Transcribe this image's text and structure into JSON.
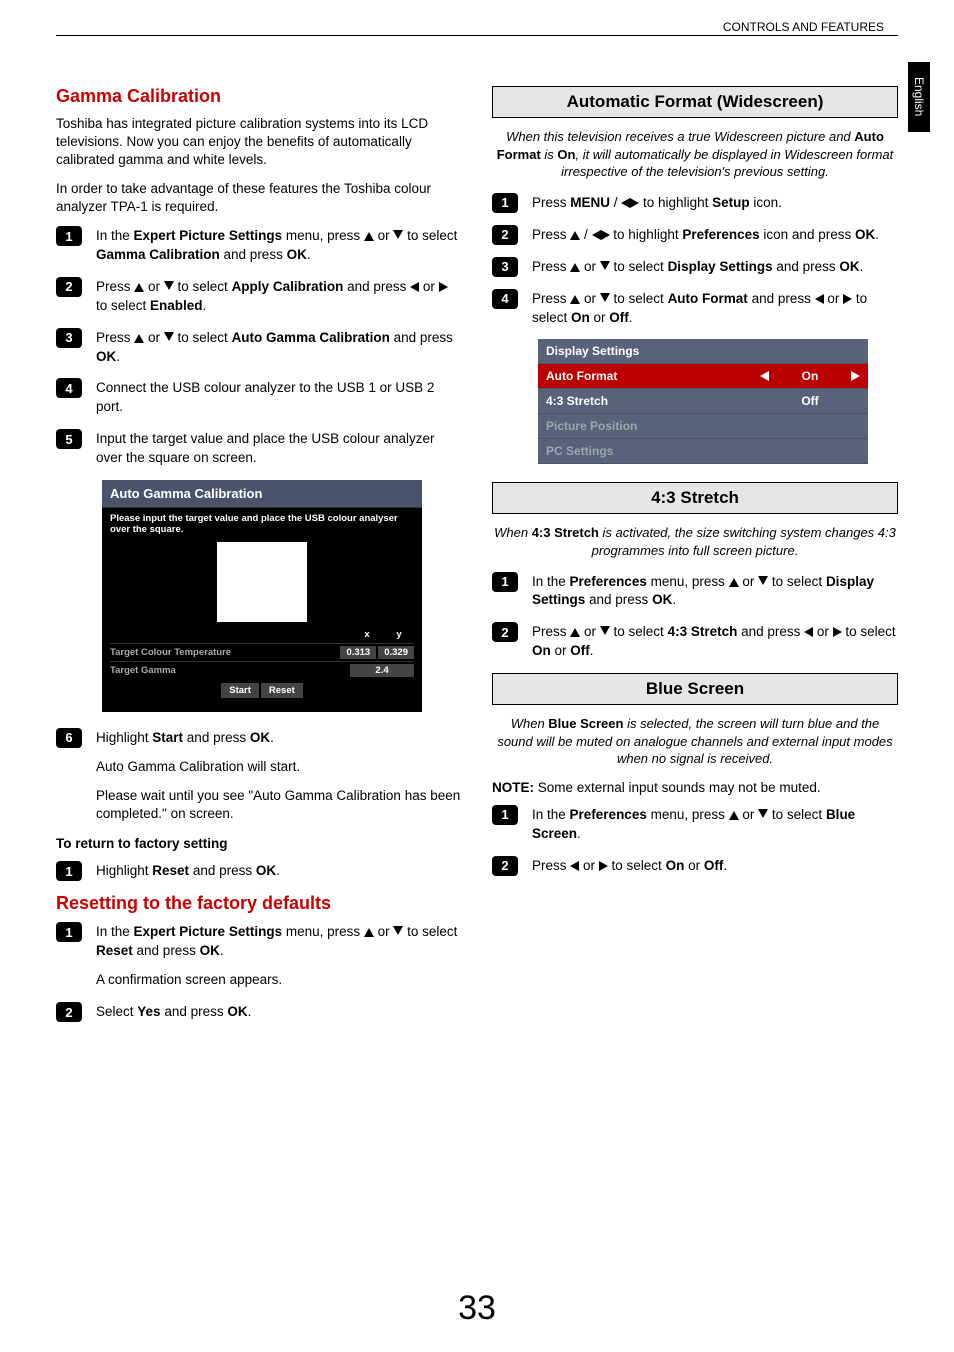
{
  "breadcrumb": "CONTROLS AND FEATURES",
  "sideTab": "English",
  "pageNumber": "33",
  "left": {
    "h1": "Gamma Calibration",
    "intro1": "Toshiba has integrated picture calibration systems into its LCD televisions. Now you can enjoy the benefits of automatically calibrated gamma and white levels.",
    "intro2": "In order to take advantage of these features the Toshiba colour analyzer TPA-1 is required.",
    "s1a": "In the ",
    "s1b": "Expert Picture Settings",
    "s1c": " menu, press ",
    "s1d": " or ",
    "s1e": " to select ",
    "s1f": "Gamma Calibration",
    "s1g": " and press ",
    "s1h": "OK",
    "s1i": ".",
    "s2a": "Press ",
    "s2b": " or ",
    "s2c": " to select ",
    "s2d": "Apply Calibration",
    "s2e": " and press ",
    "s2f": " or ",
    "s2g": " to select ",
    "s2h": "Enabled",
    "s2i": ".",
    "s3a": "Press ",
    "s3b": " or ",
    "s3c": " to select ",
    "s3d": "Auto Gamma Calibration",
    "s3e": " and press ",
    "s3f": "OK",
    "s3g": ".",
    "s4": "Connect the USB colour analyzer to the USB 1 or USB 2 port.",
    "s5": "Input the target value and place the USB colour analyzer over the square on screen.",
    "osd": {
      "title": "Auto Gamma Calibration",
      "sub": "Please input the target value and place the USB colour analyser over the square.",
      "xHead": "x",
      "yHead": "y",
      "row1l": "Target Colour Temperature",
      "row1x": "0.313",
      "row1y": "0.329",
      "row2l": "Target Gamma",
      "row2v": "2.4",
      "btnStart": "Start",
      "btnReset": "Reset"
    },
    "s6a": "Highlight ",
    "s6b": "Start",
    "s6c": " and press ",
    "s6d": "OK",
    "s6e": ".",
    "s6f": "Auto Gamma Calibration will start.",
    "s6g": "Please wait until you see \"Auto Gamma Calibration has been completed.\" on screen.",
    "returnH": "To return to factory setting",
    "r1a": "Highlight ",
    "r1b": "Reset",
    "r1c": " and press ",
    "r1d": "OK",
    "r1e": ".",
    "h2": "Resetting to the factory defaults",
    "rf1a": "In the ",
    "rf1b": "Expert Picture Settings",
    "rf1c": " menu, press ",
    "rf1d": " or ",
    "rf1e": " to select ",
    "rf1f": "Reset",
    "rf1g": " and press ",
    "rf1h": "OK",
    "rf1i": ".",
    "rf1j": "A confirmation screen appears.",
    "rf2a": "Select ",
    "rf2b": "Yes",
    "rf2c": " and press ",
    "rf2d": "OK",
    "rf2e": "."
  },
  "right": {
    "sec1h": "Automatic Format (Widescreen)",
    "sec1p_a": "When this television receives a true Widescreen picture and ",
    "sec1p_b": "Auto Format",
    "sec1p_c": " is ",
    "sec1p_d": "On",
    "sec1p_e": ", it will automatically be displayed in Widescreen format irrespective of the television's previous setting.",
    "a1a": "Press ",
    "a1b": "MENU",
    "a1c": " / ",
    "a1d": " to highlight ",
    "a1e": "Setup",
    "a1f": " icon.",
    "a2a": "Press ",
    "a2b": " / ",
    "a2c": " to highlight ",
    "a2d": "Preferences",
    "a2e": " icon and press ",
    "a2f": "OK",
    "a2g": ".",
    "a3a": "Press ",
    "a3b": " or ",
    "a3c": " to select ",
    "a3d": "Display Settings",
    "a3e": " and press ",
    "a3f": "OK",
    "a3g": ".",
    "a4a": "Press ",
    "a4b": " or ",
    "a4c": " to select ",
    "a4d": "Auto Format",
    "a4e": " and press ",
    "a4f": " or ",
    "a4g": " to select ",
    "a4h": "On",
    "a4i": " or ",
    "a4j": "Off",
    "a4k": ".",
    "osd2": {
      "title": "Display Settings",
      "r1l": "Auto Format",
      "r1v": "On",
      "r2l": "4:3 Stretch",
      "r2v": "Off",
      "r3l": "Picture Position",
      "r4l": "PC Settings"
    },
    "sec2h": "4:3 Stretch",
    "sec2p_a": "When ",
    "sec2p_b": "4:3 Stretch",
    "sec2p_c": " is activated, the size switching system changes 4:3 programmes into full screen picture.",
    "b1a": "In the ",
    "b1b": "Preferences",
    "b1c": " menu, press ",
    "b1d": " or ",
    "b1e": " to select ",
    "b1f": "Display Settings",
    "b1g": " and press ",
    "b1h": "OK",
    "b1i": ".",
    "b2a": "Press ",
    "b2b": " or ",
    "b2c": " to select ",
    "b2d": "4:3 Stretch",
    "b2e": " and press ",
    "b2f": " or ",
    "b2g": " to select ",
    "b2h": "On",
    "b2i": " or ",
    "b2j": "Off",
    "b2k": ".",
    "sec3h": "Blue Screen",
    "sec3p_a": "When ",
    "sec3p_b": "Blue Screen",
    "sec3p_c": " is selected, the screen will turn blue and the sound will be muted on analogue channels and external input modes when no signal is received.",
    "note_a": "NOTE:",
    "note_b": " Some external input sounds may not be muted.",
    "c1a": "In the ",
    "c1b": "Preferences",
    "c1c": " menu, press ",
    "c1d": " or ",
    "c1e": " to select ",
    "c1f": "Blue Screen",
    "c1g": ".",
    "c2a": "Press ",
    "c2b": " or ",
    "c2c": " to select ",
    "c2d": "On",
    "c2e": " or ",
    "c2f": "Off",
    "c2g": "."
  }
}
